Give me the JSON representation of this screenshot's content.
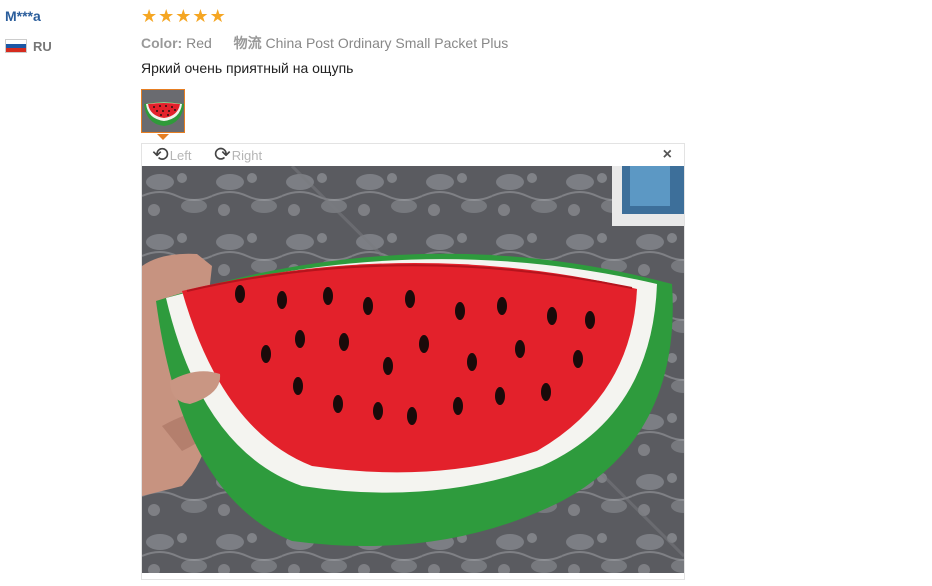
{
  "reviewer": {
    "name": "M***a",
    "country_code": "RU",
    "flag_colors": [
      "#ffffff",
      "#1c57a5",
      "#d52b1e"
    ]
  },
  "rating": {
    "value": 5,
    "max": 5,
    "star_color": "#f5a623"
  },
  "attributes": {
    "color_label": "Color:",
    "color_value": "Red",
    "shipping_label": "物流",
    "shipping_value": "China Post Ordinary Small Packet Plus"
  },
  "review_text": "Яркий очень приятный на ощупь",
  "viewer": {
    "rotate_left_label": "Left",
    "rotate_right_label": "Right",
    "close_glyph": "×",
    "accent_color": "#e67e22"
  }
}
